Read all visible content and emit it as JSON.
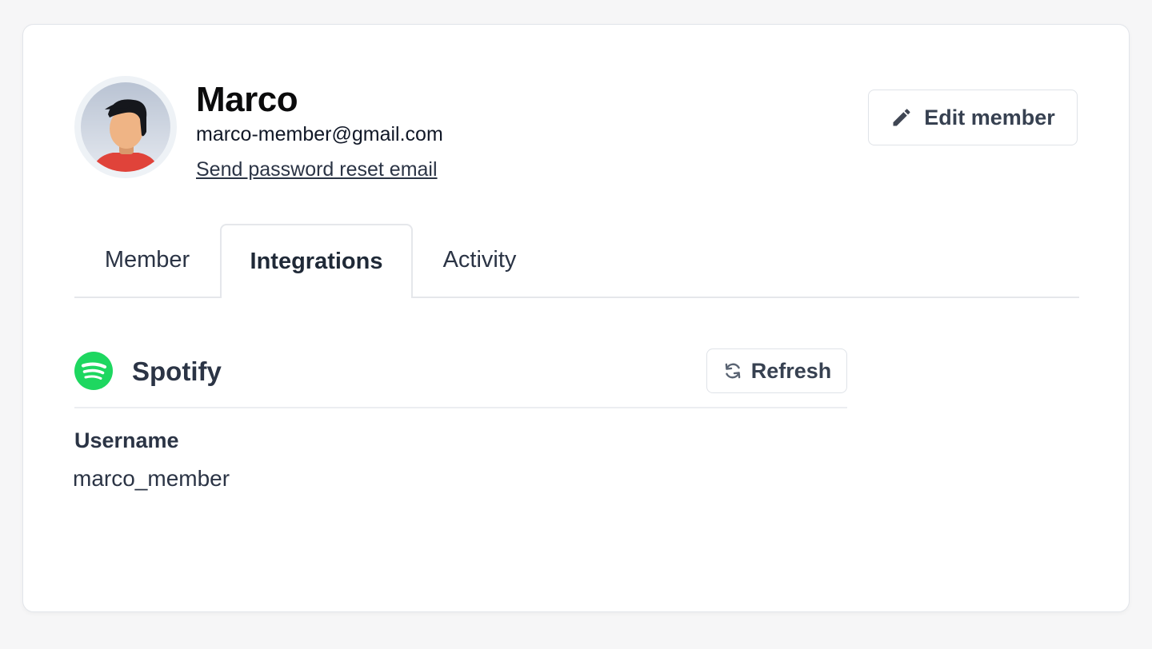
{
  "member": {
    "name": "Marco",
    "email": "marco-member@gmail.com",
    "reset_link_label": "Send password reset email",
    "avatar_icon": "avatar-illustration"
  },
  "header": {
    "edit_button_label": "Edit member",
    "edit_icon": "pencil-icon"
  },
  "tabs": [
    {
      "label": "Member",
      "active": false
    },
    {
      "label": "Integrations",
      "active": true
    },
    {
      "label": "Activity",
      "active": false
    }
  ],
  "integration": {
    "name": "Spotify",
    "logo_icon": "spotify-logo-icon",
    "brand_color": "#1ed760",
    "refresh_label": "Refresh",
    "refresh_icon": "refresh-icon",
    "fields": [
      {
        "label": "Username",
        "value": "marco_member"
      }
    ]
  }
}
